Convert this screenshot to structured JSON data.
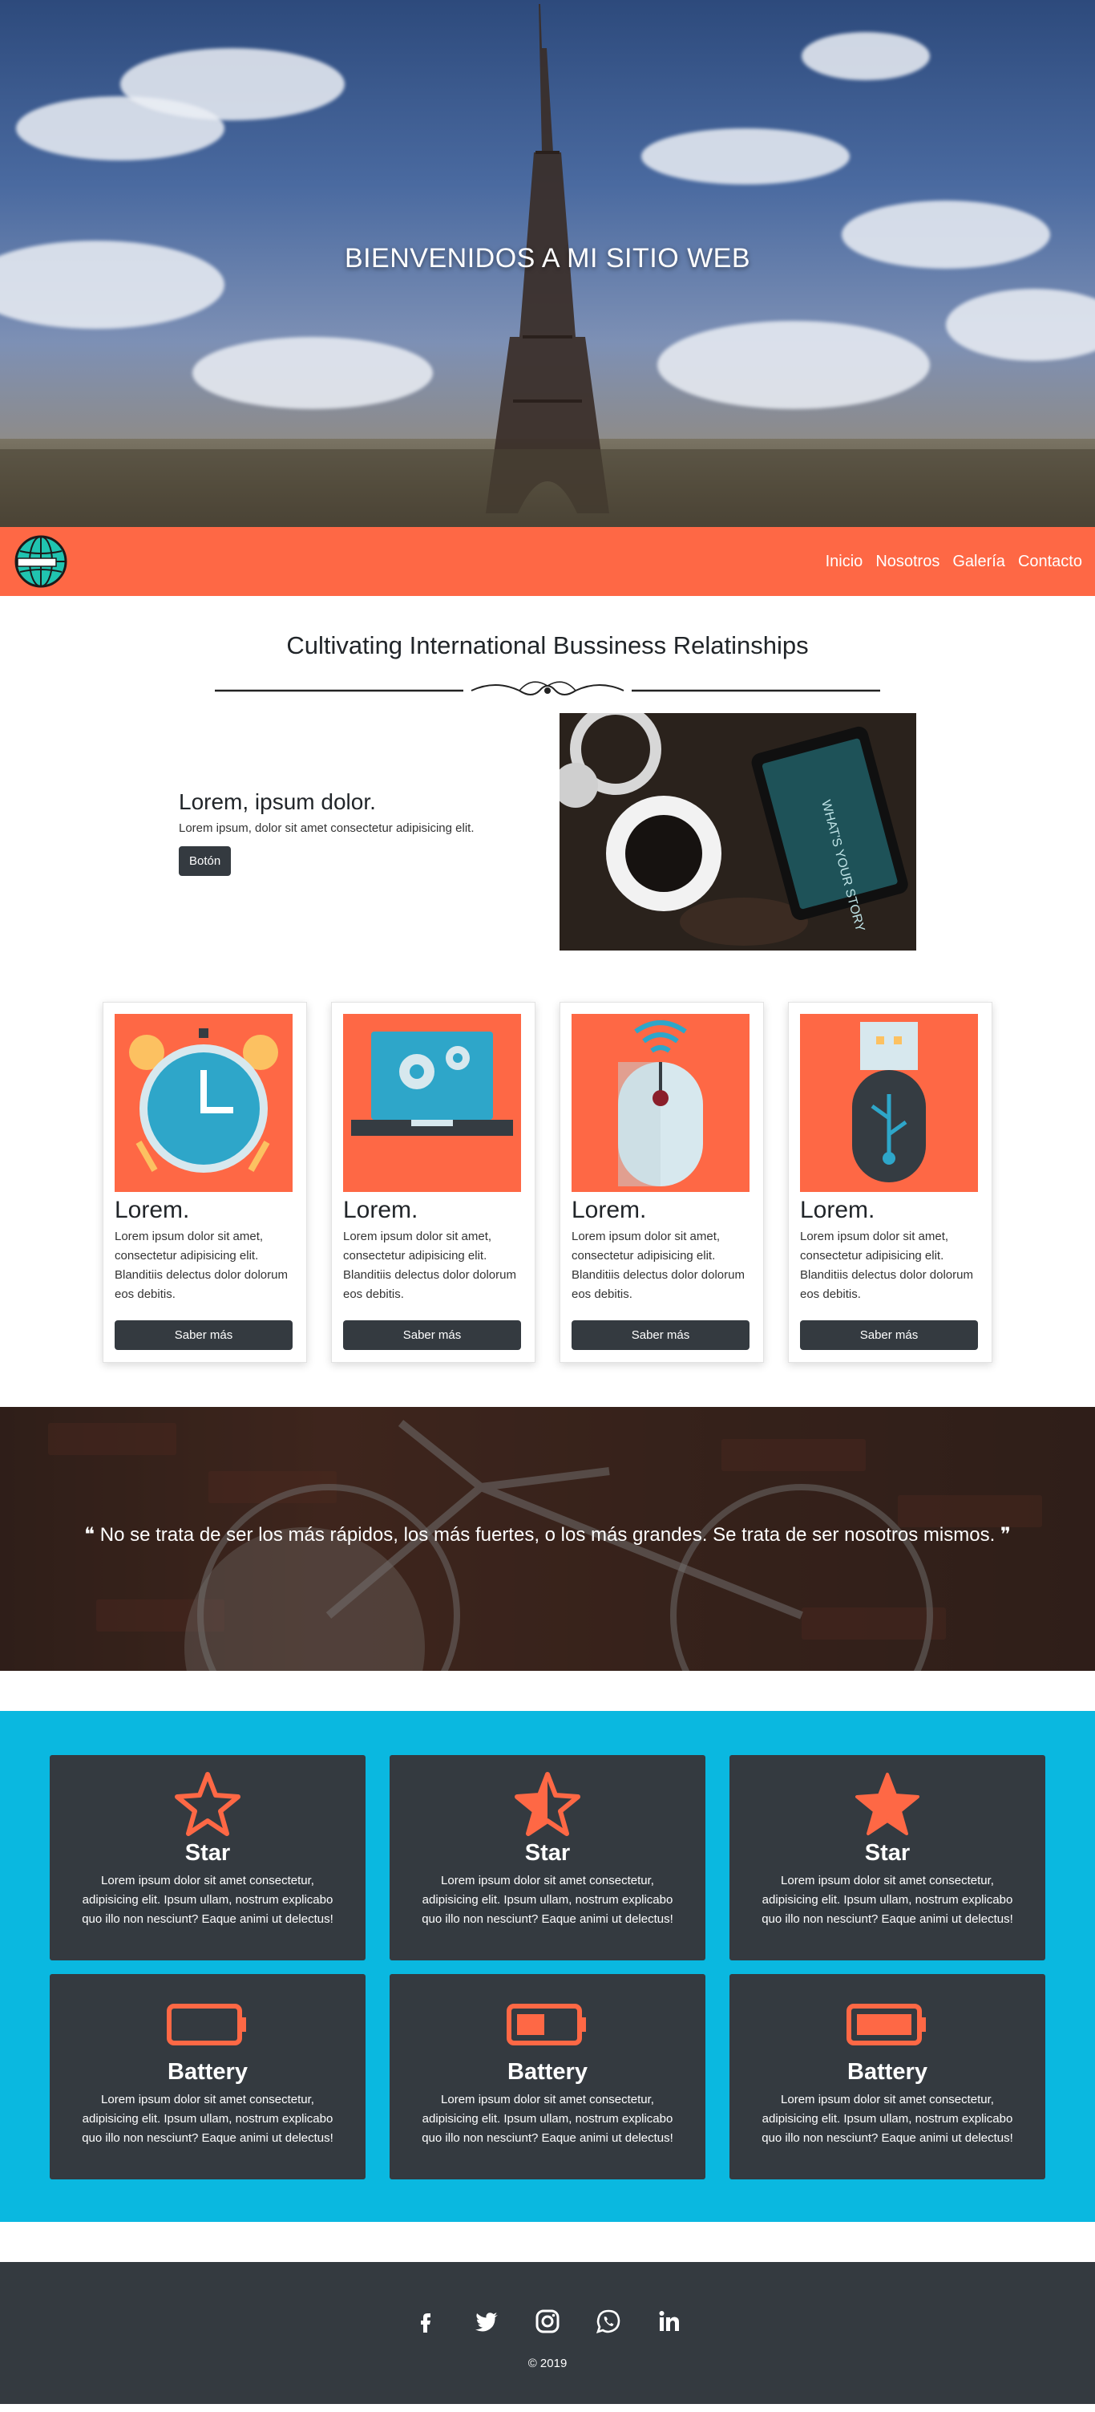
{
  "hero": {
    "title": "BIENVENIDOS A MI SITIO WEB"
  },
  "navbar": {
    "logo_icon": "globe-logo-icon",
    "links": [
      "Inicio",
      "Nosotros",
      "Galería",
      "Contacto"
    ]
  },
  "intro": {
    "title": "Cultivating International Bussiness Relatinships"
  },
  "feature": {
    "heading": "Lorem, ipsum dolor.",
    "description": "Lorem ipsum, dolor sit amet consectetur adipisicing elit.",
    "button": "Botón",
    "image_text": "WHAT'S YOUR STORY"
  },
  "cards": [
    {
      "icon": "alarm-clock-icon",
      "title": "Lorem.",
      "text": "Lorem ipsum dolor sit amet, consectetur adipisicing elit. Blanditiis delectus dolor dolorum eos debitis.",
      "button": "Saber más"
    },
    {
      "icon": "laptop-gears-icon",
      "title": "Lorem.",
      "text": "Lorem ipsum dolor sit amet, consectetur adipisicing elit. Blanditiis delectus dolor dolorum eos debitis.",
      "button": "Saber más"
    },
    {
      "icon": "wireless-mouse-icon",
      "title": "Lorem.",
      "text": "Lorem ipsum dolor sit amet, consectetur adipisicing elit. Blanditiis delectus dolor dolorum eos debitis.",
      "button": "Saber más"
    },
    {
      "icon": "usb-drive-icon",
      "title": "Lorem.",
      "text": "Lorem ipsum dolor sit amet, consectetur adipisicing elit. Blanditiis delectus dolor dolorum eos debitis.",
      "button": "Saber más"
    }
  ],
  "quote": {
    "text": "No se trata de ser los más rápidos, los más fuertes, o los más grandes. Se trata de ser nosotros mismos."
  },
  "features": [
    {
      "icon": "star-outline-icon",
      "title": "Star",
      "text": "Lorem ipsum dolor sit amet consectetur, adipisicing elit. Ipsum ullam, nostrum explicabo quo illo non nesciunt? Eaque animi ut delectus!"
    },
    {
      "icon": "star-half-icon",
      "title": "Star",
      "text": "Lorem ipsum dolor sit amet consectetur, adipisicing elit. Ipsum ullam, nostrum explicabo quo illo non nesciunt? Eaque animi ut delectus!"
    },
    {
      "icon": "star-full-icon",
      "title": "Star",
      "text": "Lorem ipsum dolor sit amet consectetur, adipisicing elit. Ipsum ullam, nostrum explicabo quo illo non nesciunt? Eaque animi ut delectus!"
    },
    {
      "icon": "battery-empty-icon",
      "title": "Battery",
      "text": "Lorem ipsum dolor sit amet consectetur, adipisicing elit. Ipsum ullam, nostrum explicabo quo illo non nesciunt? Eaque animi ut delectus!"
    },
    {
      "icon": "battery-half-icon",
      "title": "Battery",
      "text": "Lorem ipsum dolor sit amet consectetur, adipisicing elit. Ipsum ullam, nostrum explicabo quo illo non nesciunt? Eaque animi ut delectus!"
    },
    {
      "icon": "battery-full-icon",
      "title": "Battery",
      "text": "Lorem ipsum dolor sit amet consectetur, adipisicing elit. Ipsum ullam, nostrum explicabo quo illo non nesciunt? Eaque animi ut delectus!"
    }
  ],
  "footer": {
    "socials": [
      "facebook-icon",
      "twitter-icon",
      "instagram-icon",
      "whatsapp-icon",
      "linkedin-icon"
    ],
    "copyright": "© 2019"
  },
  "colors": {
    "accent": "#fe6845",
    "dark": "#343a40",
    "cyan": "#0ab8e0"
  }
}
